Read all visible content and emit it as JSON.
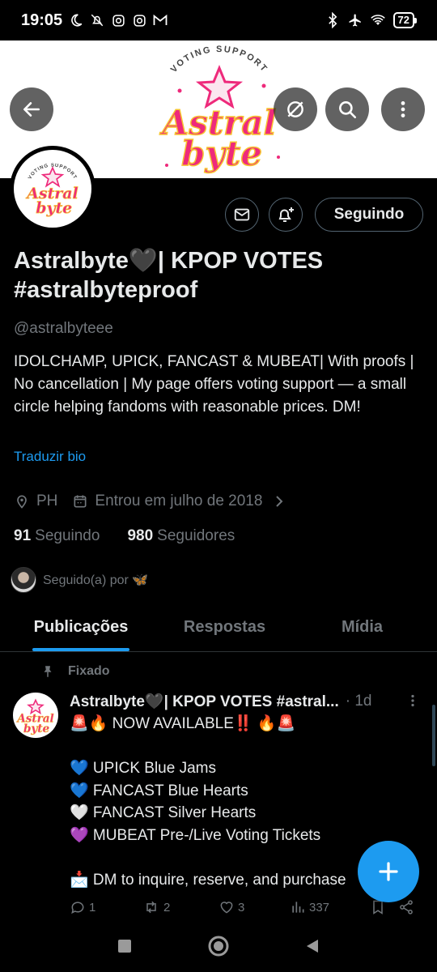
{
  "status": {
    "time": "19:05",
    "battery": "72",
    "icons_left": [
      "moon-icon",
      "mute-icon",
      "instagram-icon",
      "instagram-icon",
      "gmail-icon"
    ],
    "icons_right": [
      "bluetooth-icon",
      "airplane-icon",
      "wifi-icon",
      "battery-icon"
    ]
  },
  "banner": {
    "arc_text": "VOTING SUPPORT",
    "logo_line1": "Astral",
    "logo_line2": "byte",
    "avatar_arc_text": "VOTING SUPPORT"
  },
  "profile": {
    "name": "Astralbyte🖤| KPOP VOTES #astralbyteproof",
    "handle": "@astralbyteee",
    "bio": "IDOLCHAMP, UPICK, FANCAST & MUBEAT| With proofs | No cancellation | My page offers voting support — a small circle helping fandoms with reasonable prices. DM!",
    "translate_label": "Traduzir bio",
    "location": "PH",
    "joined": "Entrou em julho de 2018",
    "following_count": "91",
    "following_label": "Seguindo",
    "followers_count": "980",
    "followers_label": "Seguidores",
    "followed_by": "Seguido(a) por 🦋",
    "follow_button": "Seguindo"
  },
  "tabs": [
    {
      "label": "Publicações",
      "active": true
    },
    {
      "label": "Respostas",
      "active": false
    },
    {
      "label": "Mídia",
      "active": false
    }
  ],
  "post": {
    "pinned_label": "Fixado",
    "name": "Astralbyte🖤| KPOP VOTES #astral...",
    "time": "· 1d",
    "text": "🚨🔥 NOW AVAILABLE‼️ 🔥🚨\n\n💙 UPICK Blue Jams\n💙 FANCAST Blue Hearts\n🤍 FANCAST Silver Hearts\n💜 MUBEAT Pre-/Live Voting Tickets\n\n📩 DM to inquire, reserve, and purchase",
    "replies": "1",
    "reposts": "2",
    "likes": "3",
    "views": "337"
  },
  "colors": {
    "accent": "#1d9bf0",
    "logo_pink": "#ee2a7b",
    "logo_yellow": "#f7c531"
  }
}
